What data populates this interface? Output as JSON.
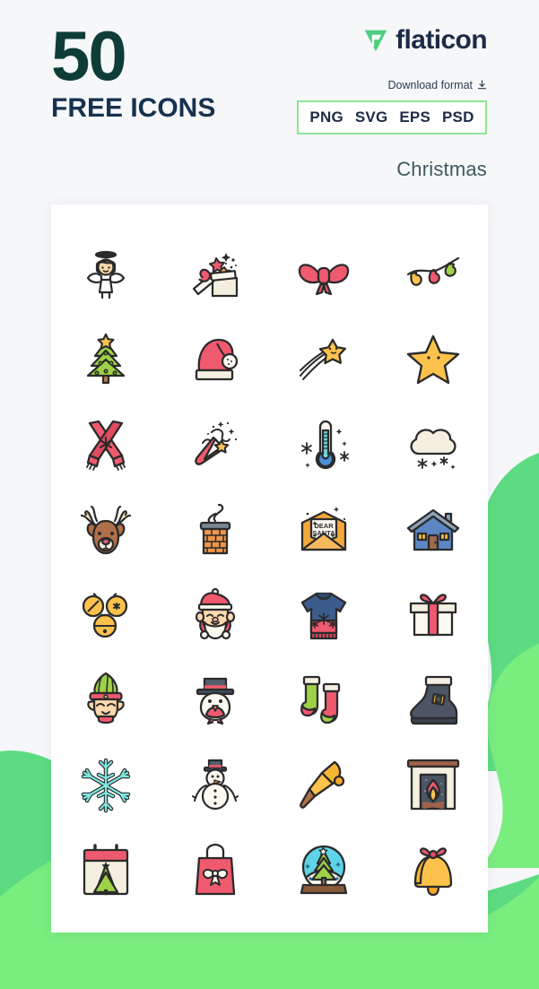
{
  "header": {
    "count_number": "50",
    "count_label": "FREE ICONS",
    "brand_name": "flaticon",
    "brand_mark_icon": "flaticon-logo-icon",
    "download_label": "Download format",
    "download_icon": "download-icon",
    "formats": [
      "PNG",
      "SVG",
      "EPS",
      "PSD"
    ],
    "pack_title": "Christmas"
  },
  "colors": {
    "page_background": "#f5f7f9",
    "count_number_color": "#0e3d38",
    "count_label_color": "#163250",
    "brand_text_color": "#1d2b46",
    "brand_mark_color": "#4ccf7f",
    "format_border": "#8ee493",
    "format_text": "#1d2b46",
    "pack_title_color": "#3d5a5e",
    "card_background": "#ffffff",
    "blob_green_dark": "#5ddb82",
    "blob_green_light": "#7aed7f",
    "icon_outline": "#2b2b2b",
    "icon_red": "#f05a6e",
    "icon_yellow": "#fcc24c",
    "icon_green": "#9fd148",
    "icon_blue": "#5c87c4",
    "icon_cream": "#f4efe0"
  },
  "card": {
    "icons": [
      {
        "row": 1,
        "col": 1,
        "name": "angel-icon",
        "label": "Angel"
      },
      {
        "row": 1,
        "col": 2,
        "name": "open-gift-icon",
        "label": "Open gift box"
      },
      {
        "row": 1,
        "col": 3,
        "name": "bow-icon",
        "label": "Ribbon bow"
      },
      {
        "row": 1,
        "col": 4,
        "name": "string-lights-icon",
        "label": "Christmas lights"
      },
      {
        "row": 2,
        "col": 1,
        "name": "christmas-tree-icon",
        "label": "Christmas tree"
      },
      {
        "row": 2,
        "col": 2,
        "name": "santa-hat-icon",
        "label": "Santa hat"
      },
      {
        "row": 2,
        "col": 3,
        "name": "shooting-star-icon",
        "label": "Shooting star"
      },
      {
        "row": 2,
        "col": 4,
        "name": "star-icon",
        "label": "Star"
      },
      {
        "row": 3,
        "col": 1,
        "name": "scarf-icon",
        "label": "Scarf"
      },
      {
        "row": 3,
        "col": 2,
        "name": "party-popper-icon",
        "label": "Party popper"
      },
      {
        "row": 3,
        "col": 3,
        "name": "thermometer-icon",
        "label": "Cold thermometer"
      },
      {
        "row": 3,
        "col": 4,
        "name": "snow-cloud-icon",
        "label": "Snow cloud"
      },
      {
        "row": 4,
        "col": 1,
        "name": "reindeer-icon",
        "label": "Reindeer"
      },
      {
        "row": 4,
        "col": 2,
        "name": "chimney-icon",
        "label": "Chimney"
      },
      {
        "row": 4,
        "col": 3,
        "name": "santa-letter-icon",
        "label": "Dear Santa letter"
      },
      {
        "row": 4,
        "col": 4,
        "name": "house-icon",
        "label": "House"
      },
      {
        "row": 5,
        "col": 1,
        "name": "jingle-bells-icon",
        "label": "Jingle bells"
      },
      {
        "row": 5,
        "col": 2,
        "name": "santa-claus-icon",
        "label": "Santa Claus"
      },
      {
        "row": 5,
        "col": 3,
        "name": "sweater-icon",
        "label": "Christmas sweater"
      },
      {
        "row": 5,
        "col": 4,
        "name": "gift-box-icon",
        "label": "Gift box"
      },
      {
        "row": 6,
        "col": 1,
        "name": "elf-icon",
        "label": "Elf"
      },
      {
        "row": 6,
        "col": 2,
        "name": "snowman-head-icon",
        "label": "Snowman head"
      },
      {
        "row": 6,
        "col": 3,
        "name": "socks-icon",
        "label": "Christmas socks"
      },
      {
        "row": 6,
        "col": 4,
        "name": "boot-icon",
        "label": "Boot"
      },
      {
        "row": 7,
        "col": 1,
        "name": "snowflake-icon",
        "label": "Snowflake"
      },
      {
        "row": 7,
        "col": 2,
        "name": "snowman-icon",
        "label": "Snowman"
      },
      {
        "row": 7,
        "col": 3,
        "name": "hand-bell-icon",
        "label": "Hand bell"
      },
      {
        "row": 7,
        "col": 4,
        "name": "fireplace-icon",
        "label": "Fireplace"
      },
      {
        "row": 8,
        "col": 1,
        "name": "calendar-icon",
        "label": "Christmas calendar"
      },
      {
        "row": 8,
        "col": 2,
        "name": "shopping-bag-icon",
        "label": "Shopping bag"
      },
      {
        "row": 8,
        "col": 3,
        "name": "snow-globe-icon",
        "label": "Snow globe"
      },
      {
        "row": 8,
        "col": 4,
        "name": "bell-icon",
        "label": "Bell"
      }
    ],
    "letter_text_line1": "DEAR",
    "letter_text_line2": "SANTA"
  }
}
